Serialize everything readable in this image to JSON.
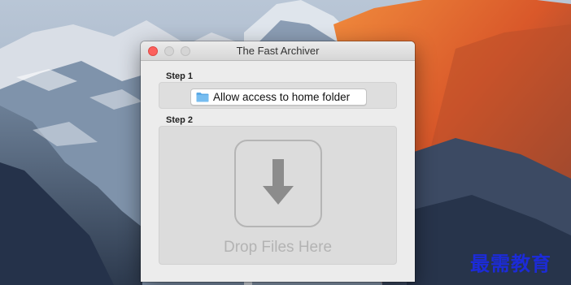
{
  "window": {
    "title": "The Fast Archiver",
    "controls": [
      "close",
      "minimize",
      "zoom"
    ]
  },
  "step1": {
    "label": "Step 1",
    "button_label": "Allow access to home folder",
    "button_icon": "folder-icon"
  },
  "step2": {
    "label": "Step 2",
    "drop_text": "Drop Files Here",
    "drop_icon": "download-arrow-icon"
  },
  "watermark": "最需教育",
  "colors": {
    "close": "#fc605c",
    "folder": "#5aa9e6",
    "watermark": "#1c2bd8"
  }
}
